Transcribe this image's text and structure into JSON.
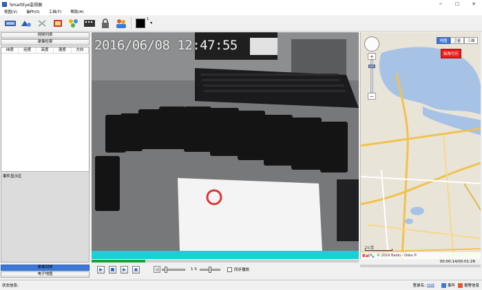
{
  "window": {
    "title": "SmartEye监视器"
  },
  "menu": {
    "items": [
      "视图(V)",
      "操作(O)",
      "工具(T)",
      "帮助(H)"
    ]
  },
  "toolbar": {
    "color_index": "1",
    "accent": "#000000"
  },
  "left_panel": {
    "btn_video_list": "视频列表",
    "btn_record_search": "录像检索",
    "list_columns": [
      "纬度",
      "经度",
      "高度",
      "速度",
      "方向"
    ],
    "event_area_title": "事件显示区",
    "btn_record_playback": "录像回放",
    "btn_emap": "电子地图"
  },
  "video": {
    "timestamp": "2016/06/08 12:47:55"
  },
  "map": {
    "type_tabs": [
      "地图",
      "卫星",
      "三维"
    ],
    "pin_label": "街角可乐",
    "scale_text": "2公里",
    "copyright": "© 2016 Baidu - Data ©",
    "time_display": "00:00:14/00:01:28"
  },
  "playback": {
    "progress_pct": 20,
    "speed_label": "1 X",
    "sync_label": "同步播放"
  },
  "status": {
    "left_label": "状态信息:",
    "login_label": "登录名:",
    "user": "root",
    "event_label": "事件",
    "alarm_label": "报警信息"
  }
}
